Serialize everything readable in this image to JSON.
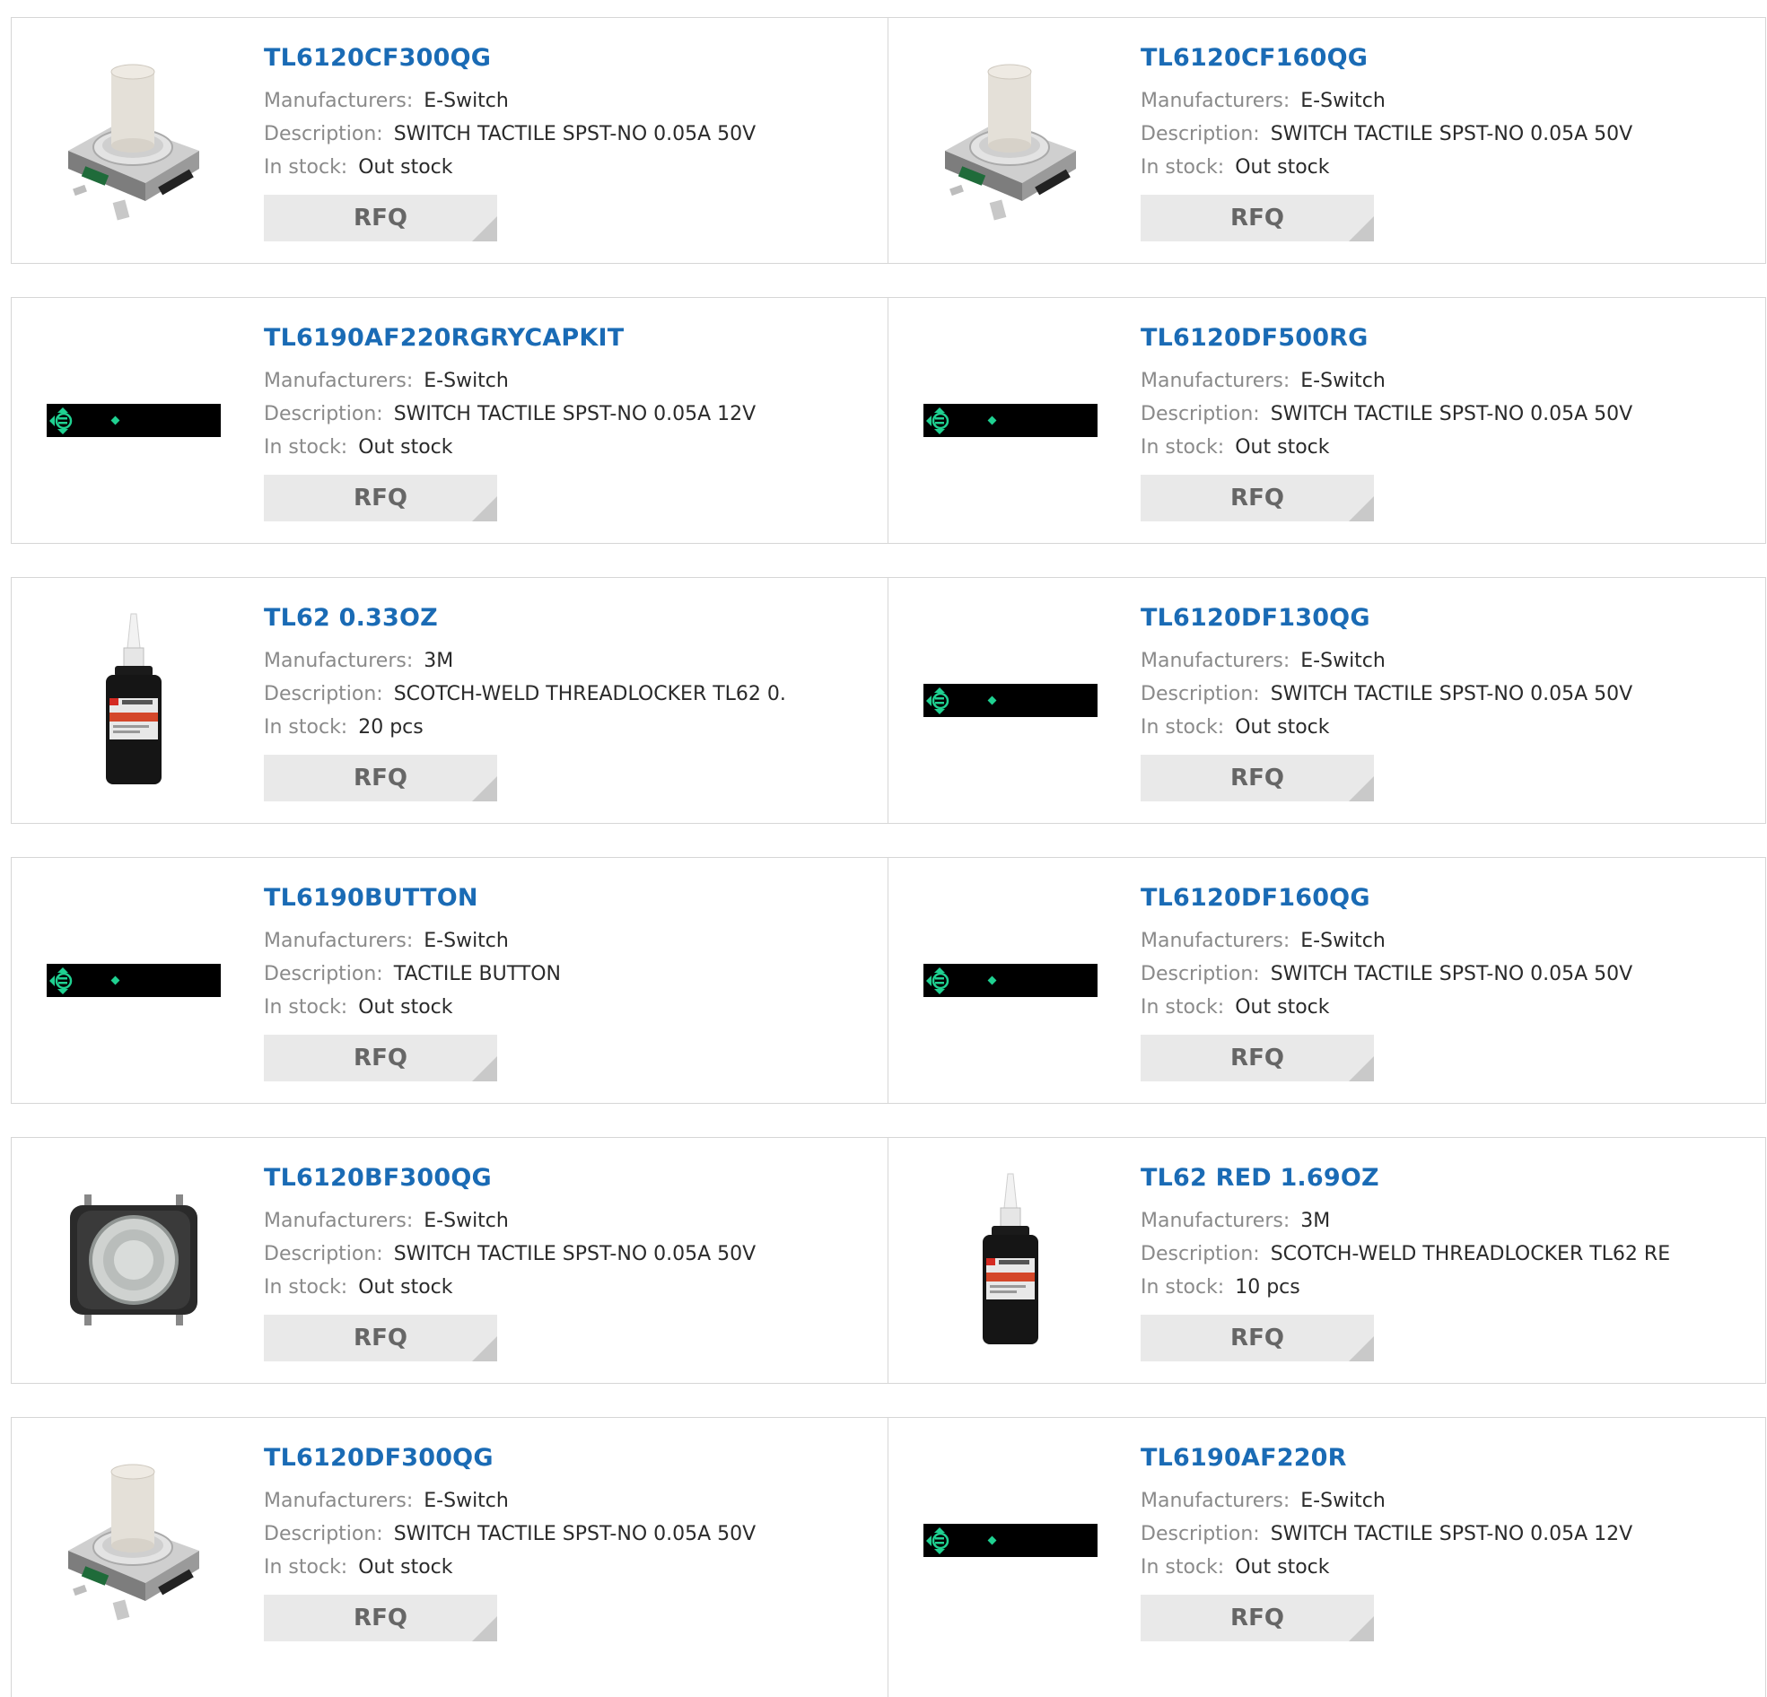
{
  "labels": {
    "manufacturers": "Manufacturers:",
    "description": "Description:",
    "in_stock": "In stock:",
    "rfq": "RFQ"
  },
  "products": [
    {
      "part": "TL6120CF300QG",
      "manufacturer": "E-Switch",
      "description": "SWITCH TACTILE SPST-NO 0.05A 50V",
      "stock": "Out stock",
      "image": "tactile-switch"
    },
    {
      "part": "TL6120CF160QG",
      "manufacturer": "E-Switch",
      "description": "SWITCH TACTILE SPST-NO 0.05A 50V",
      "stock": "Out stock",
      "image": "tactile-switch"
    },
    {
      "part": "TL6190AF220RGRYCAPKIT",
      "manufacturer": "E-Switch",
      "description": "SWITCH TACTILE SPST-NO 0.05A 12V",
      "stock": "Out stock",
      "image": "placeholder"
    },
    {
      "part": "TL6120DF500RG",
      "manufacturer": "E-Switch",
      "description": "SWITCH TACTILE SPST-NO 0.05A 50V",
      "stock": "Out stock",
      "image": "placeholder"
    },
    {
      "part": "TL62 0.33OZ",
      "manufacturer": "3M",
      "description": "SCOTCH-WELD THREADLOCKER TL62 0.",
      "stock": "20 pcs",
      "image": "threadlocker-bottle"
    },
    {
      "part": "TL6120DF130QG",
      "manufacturer": "E-Switch",
      "description": "SWITCH TACTILE SPST-NO 0.05A 50V",
      "stock": "Out stock",
      "image": "placeholder"
    },
    {
      "part": "TL6190BUTTON",
      "manufacturer": "E-Switch",
      "description": "TACTILE BUTTON",
      "stock": "Out stock",
      "image": "placeholder"
    },
    {
      "part": "TL6120DF160QG",
      "manufacturer": "E-Switch",
      "description": "SWITCH TACTILE SPST-NO 0.05A 50V",
      "stock": "Out stock",
      "image": "placeholder"
    },
    {
      "part": "TL6120BF300QG",
      "manufacturer": "E-Switch",
      "description": "SWITCH TACTILE SPST-NO 0.05A 50V",
      "stock": "Out stock",
      "image": "tactile-switch-top"
    },
    {
      "part": "TL62 RED 1.69OZ",
      "manufacturer": "3M",
      "description": "SCOTCH-WELD THREADLOCKER TL62 RE",
      "stock": "10 pcs",
      "image": "threadlocker-bottle"
    },
    {
      "part": "TL6120DF300QG",
      "manufacturer": "E-Switch",
      "description": "SWITCH TACTILE SPST-NO 0.05A 50V",
      "stock": "Out stock",
      "image": "tactile-switch"
    },
    {
      "part": "TL6190AF220R",
      "manufacturer": "E-Switch",
      "description": "SWITCH TACTILE SPST-NO 0.05A 12V",
      "stock": "Out stock",
      "image": "placeholder"
    }
  ],
  "colors": {
    "part_link": "#1a6bb5",
    "label": "#8a8a8a",
    "value": "#2a2a2a",
    "rfq_bg": "#e9e9e9",
    "placeholder_accent": "#1fd191"
  }
}
